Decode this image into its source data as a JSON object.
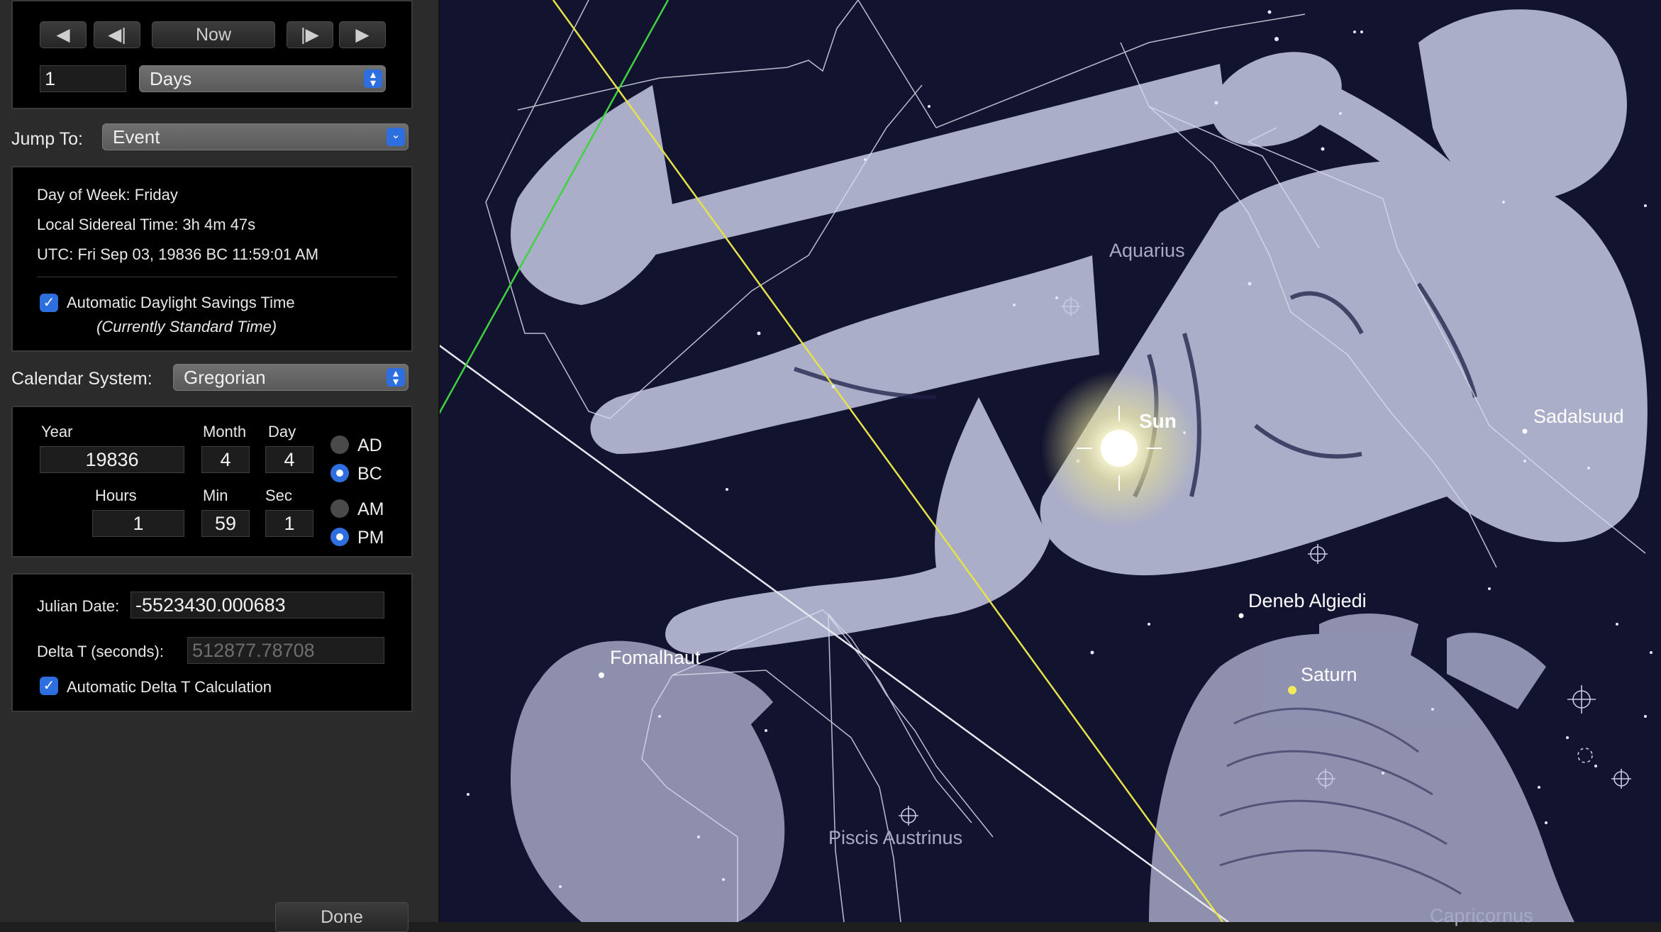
{
  "time_panel": {
    "step_buttons": {
      "back": "◀",
      "step_back": "◀|",
      "now": "Now",
      "step_forward": "|▶",
      "forward": "▶"
    },
    "step_value": "1",
    "step_unit": "Days",
    "jump_to_label": "Jump To:",
    "jump_to_value": "Event",
    "info": {
      "day_of_week": "Day of Week:  Friday",
      "sidereal": "Local Sidereal Time:  3h 4m 47s",
      "utc": "UTC:  Fri Sep 03, 19836 BC 11:59:01 AM"
    },
    "dst_checkbox_label": "Automatic Daylight Savings Time",
    "dst_note": "(Currently Standard Time)",
    "calendar_label": "Calendar System:",
    "calendar_value": "Gregorian",
    "date": {
      "year_label": "Year",
      "year": "19836",
      "month_label": "Month",
      "month": "4",
      "day_label": "Day",
      "day": "4",
      "ad_label": "AD",
      "bc_label": "BC"
    },
    "time": {
      "hours_label": "Hours",
      "hours": "1",
      "min_label": "Min",
      "min": "59",
      "sec_label": "Sec",
      "sec": "1",
      "am_label": "AM",
      "pm_label": "PM"
    },
    "julian_label": "Julian Date:",
    "julian_value": "-5523430.000683",
    "delta_t_label": "Delta T (seconds):",
    "delta_t_value": "512877.78708",
    "delta_checkbox_label": "Automatic Delta T Calculation",
    "done_label": "Done"
  },
  "sky_map": {
    "labels": {
      "aquarius": "Aquarius",
      "sun": "Sun",
      "sadalsuud": "Sadalsuud",
      "deneb_algiedi": "Deneb Algiedi",
      "saturn": "Saturn",
      "fomalhaut": "Fomalhaut",
      "piscis_austrinus": "Piscis Austrinus",
      "capricornus": "Capricornus"
    },
    "colors": {
      "background": "#12132e",
      "ecliptic": "#e6e24a",
      "horizon": "#3fd43f",
      "meridian": "#e8e8f0",
      "constellation_art": "#b9bcd6"
    }
  }
}
